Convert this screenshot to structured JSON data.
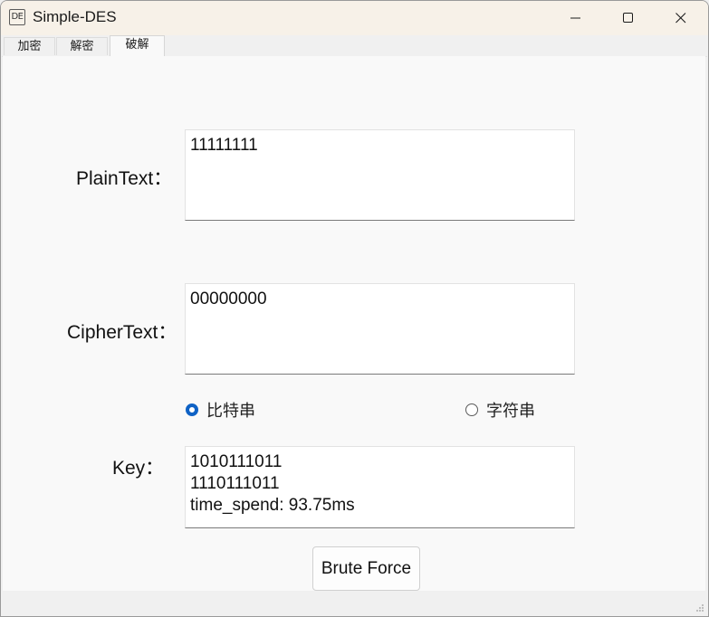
{
  "window": {
    "icon_text": "DE",
    "title": "Simple-DES"
  },
  "tabs": [
    {
      "label": "加密"
    },
    {
      "label": "解密"
    },
    {
      "label": "破解"
    }
  ],
  "form": {
    "plaintext_label": "PlainText：",
    "plaintext_value": "11111111",
    "ciphertext_label": "CipherText：",
    "ciphertext_value": "00000000",
    "mode_options": [
      {
        "label": "比特串",
        "checked": true
      },
      {
        "label": "字符串",
        "checked": false
      }
    ],
    "key_label": "Key：",
    "key_value": "1010111011\n1110111011\ntime_spend: 93.75ms",
    "brute_force_label": "Brute Force"
  },
  "colors": {
    "titlebar_bg": "#f7f1e8",
    "accent": "#0f62c5",
    "panel_bg": "#f9f9f9"
  }
}
